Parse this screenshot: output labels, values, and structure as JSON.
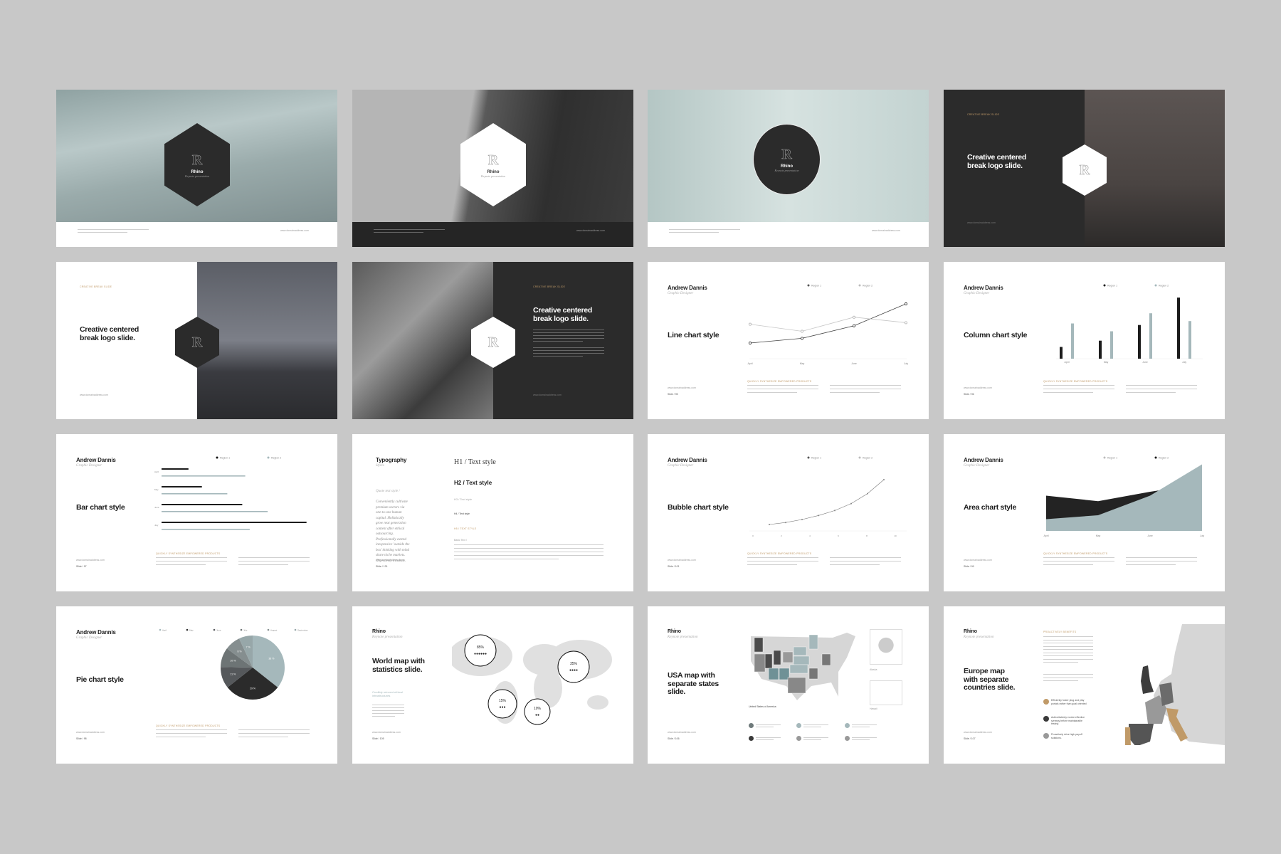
{
  "colors": {
    "page_bg": "#c8c8c8",
    "dark": "#2b2b2b",
    "accent_blue": "#a5b8bb",
    "accent_gold": "#c09a68",
    "light_gray": "#d6d6d6"
  },
  "common": {
    "brand": "Rhino",
    "tagline": "Keynote presentation",
    "url": "www.domainaddress.com",
    "author": "Andrew Dannis",
    "role": "Graphic Designer",
    "break_label": "CREATIVE BREAK SLIDE",
    "break_title": "Creative centered break logo slide.",
    "section_heading": "QUICKLY SYNTHESIZE EMPOWERED PRODUCTS",
    "region1": "Region 1",
    "region2": "Region 2",
    "months": [
      "April",
      "May",
      "June",
      "July"
    ]
  },
  "slides": [
    {
      "type": "cover",
      "image": "clouds",
      "hex": "dark",
      "shape": "hexagon"
    },
    {
      "type": "cover",
      "image": "building",
      "hex": "light",
      "shape": "hexagon",
      "footer": "dark"
    },
    {
      "type": "cover",
      "image": "interior",
      "hex": "dark",
      "shape": "circle"
    },
    {
      "type": "break-dark-left",
      "image": "shelves"
    },
    {
      "type": "break-light-left",
      "image": "road"
    },
    {
      "type": "break-dark-right",
      "image": "architecture"
    },
    {
      "type": "chart",
      "title": "Line chart style",
      "slide_no": "Slide / 95",
      "chart": "line"
    },
    {
      "type": "chart",
      "title": "Column chart style",
      "slide_no": "Slide / 96",
      "chart": "column"
    },
    {
      "type": "chart",
      "title": "Bar chart style",
      "slide_no": "Slide / 97",
      "chart": "bar"
    },
    {
      "type": "typography",
      "title": "Typography",
      "subtitle": "Styles",
      "quote_label": "Quote text style /",
      "quote": "Conveniently cultivate premium sectors via one-to-one human capital. Holistically grow next generation content after ethical outsourcing. Professionally extend inexpensive 'outside the box' thinking with mind share niche markets. Objectively incubate.",
      "h1": "H1 / Text style",
      "h2": "H2 / Text style",
      "h3": "H3 / Text style",
      "h4": "H4 / Text style",
      "h5": "H5 / TEXT STYLE",
      "basic": "Basic Text /",
      "slide_no": "Slide / 131"
    },
    {
      "type": "chart",
      "title": "Bubble chart style",
      "slide_no": "Slide / 101",
      "chart": "bubble"
    },
    {
      "type": "chart",
      "title": "Area chart style",
      "slide_no": "Slide / 99",
      "chart": "area"
    },
    {
      "type": "chart",
      "title": "Pie chart style",
      "slide_no": "Slide / 98",
      "chart": "pie"
    },
    {
      "type": "world",
      "title": "World map with statistics slide.",
      "subtitle": "Credibly reinvent ethical infrastructures",
      "slide_no": "Slide / 105",
      "stats": [
        "85%",
        "35%",
        "15%",
        "10%"
      ]
    },
    {
      "type": "usa",
      "title": "USA map with separate states slide.",
      "map_label": "United States of America",
      "alaska": "Alaska",
      "hawaii": "Hawaii",
      "slide_no": "Slide / 106"
    },
    {
      "type": "europe",
      "title": "Europe map with separate countries slide.",
      "heading": "PROACTIVELY BENEFITS",
      "legend": [
        {
          "text": "Efficiently foster plug and play portals rather than goal oriented",
          "color": "#c09a68"
        },
        {
          "text": "Authoritatively evolve effective synergy before maintainable testing",
          "color": "#3a3a3a"
        },
        {
          "text": "Proactively drive high payoff solutions.",
          "color": "#999999"
        }
      ],
      "slide_no": "Slide / 107"
    }
  ],
  "chart_data": [
    {
      "type": "line",
      "categories": [
        "April",
        "May",
        "June",
        "July"
      ],
      "series": [
        {
          "name": "Region 1",
          "values": [
            2.0,
            2.6,
            4.2,
            7.0
          ]
        },
        {
          "name": "Region 2",
          "values": [
            4.4,
            3.5,
            5.3,
            4.6
          ]
        }
      ]
    },
    {
      "type": "bar",
      "orientation": "vertical",
      "categories": [
        "April",
        "May",
        "June",
        "July"
      ],
      "series": [
        {
          "name": "Region 1",
          "values": [
            1.5,
            2.3,
            4.3,
            7.8
          ]
        },
        {
          "name": "Region 2",
          "values": [
            4.5,
            3.5,
            5.8,
            4.8
          ]
        }
      ]
    },
    {
      "type": "bar",
      "orientation": "horizontal",
      "categories": [
        "April",
        "May",
        "June",
        "July"
      ],
      "series": [
        {
          "name": "Region 1",
          "values": [
            1.8,
            2.7,
            5.4,
            9.7
          ]
        },
        {
          "name": "Region 2",
          "values": [
            5.6,
            4.4,
            7.1,
            5.9
          ]
        }
      ]
    },
    {
      "type": "scatter",
      "series": [
        {
          "name": "Region 1",
          "x": [
            1,
            2,
            3,
            4,
            5,
            6,
            7,
            8
          ],
          "y": [
            0.5,
            0.7,
            1.0,
            1.4,
            1.9,
            2.6,
            3.6,
            5.0
          ]
        }
      ],
      "xticks": [
        0,
        2,
        4,
        6,
        8,
        10
      ]
    },
    {
      "type": "area",
      "categories": [
        "April",
        "May",
        "June",
        "July"
      ],
      "series": [
        {
          "name": "Region 1",
          "values": [
            4.5,
            3.8,
            5.0,
            6.0
          ]
        },
        {
          "name": "Region 2",
          "values": [
            1.5,
            2.0,
            4.5,
            8.5
          ]
        }
      ]
    },
    {
      "type": "pie",
      "labels": [
        "April",
        "May",
        "June",
        "July",
        "August",
        "September"
      ],
      "values": [
        36,
        29,
        11,
        10,
        8,
        7
      ],
      "value_labels": [
        "36 %",
        "29 %",
        "11 %",
        "10 %",
        "8 %",
        "7 %"
      ],
      "colors": [
        "#a5b8bb",
        "#2b2b2b",
        "#55585b",
        "#6d7475",
        "#858e8f",
        "#97a7a9"
      ]
    }
  ]
}
